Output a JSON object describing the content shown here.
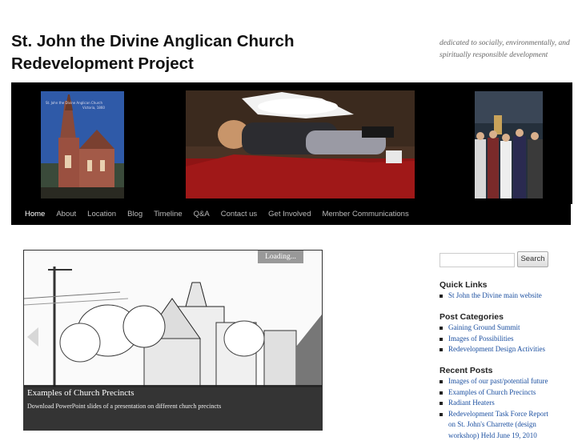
{
  "site": {
    "title_line1": "St. John the Divine Anglican Church",
    "title_line2": "Redevelopment Project",
    "tagline_line1": "dedicated to socially, environmentally, and",
    "tagline_line2": "spiritually responsible development"
  },
  "header_images": {
    "church_photo_text_line1": "St. John the Divine Anglican Church",
    "church_photo_text_line2": "Victoria, 1860"
  },
  "nav": {
    "items": [
      "Home",
      "About",
      "Location",
      "Blog",
      "Timeline",
      "Q&A",
      "Contact us",
      "Get Involved",
      "Member Communications"
    ],
    "active": "Home"
  },
  "slider": {
    "loading_label": "Loading...",
    "caption_title": "Examples of Church Precincts",
    "caption_text": "Download PowerPoint slides of a presentation on different church precincts"
  },
  "sidebar": {
    "search_placeholder": "",
    "search_button": "Search",
    "quick_links": {
      "title": "Quick Links",
      "items": [
        "St John the Divine main website"
      ]
    },
    "post_categories": {
      "title": "Post Categories",
      "items": [
        "Gaining Ground Summit",
        "Images of Possibilities",
        "Redevelopment Design Activities"
      ]
    },
    "recent_posts": {
      "title": "Recent Posts",
      "items": [
        "Images of our past/potential future",
        "Examples of Church Precincts",
        "Radiant Heaters",
        "Redevelopment Task Force Report on St. John's Charrette (design workshop) Held June 19, 2010"
      ]
    }
  },
  "colors": {
    "header_bg": "#000000",
    "link": "#1b4fa0",
    "nav_active": "#ffffff",
    "nav_text": "#bbbbbb"
  }
}
